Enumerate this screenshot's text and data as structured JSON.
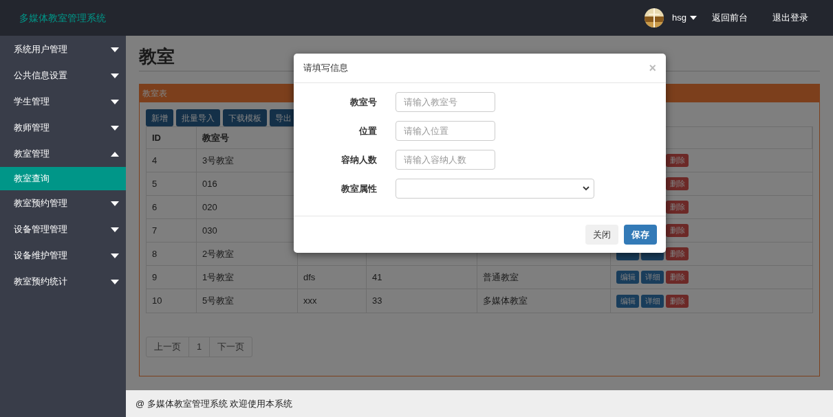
{
  "header": {
    "brand": "多媒体教室管理系统",
    "user": "hsg",
    "links": [
      "返回前台",
      "退出登录"
    ]
  },
  "sidebar": {
    "items": [
      {
        "label": "系统用户管理",
        "expanded": false
      },
      {
        "label": "公共信息设置",
        "expanded": false
      },
      {
        "label": "学生管理",
        "expanded": false
      },
      {
        "label": "教师管理",
        "expanded": false
      },
      {
        "label": "教室管理",
        "expanded": true,
        "children": [
          {
            "label": "教室查询",
            "selected": true
          }
        ]
      },
      {
        "label": "教室预约管理",
        "expanded": false
      },
      {
        "label": "设备管理管理",
        "expanded": false
      },
      {
        "label": "设备维护管理",
        "expanded": false
      },
      {
        "label": "教室预约统计",
        "expanded": false
      }
    ]
  },
  "page_title": "教室",
  "panel": {
    "title": "教室表",
    "toolbar": [
      "新增",
      "批量导入",
      "下载模板",
      "导出"
    ],
    "table": {
      "columns": [
        "ID",
        "教室号"
      ],
      "rows": [
        {
          "cells": [
            "4",
            "3号教室"
          ],
          "actions": [
            {
              "kind": "delete",
              "label": "删除"
            }
          ]
        },
        {
          "cells": [
            "5",
            "016"
          ],
          "actions": [
            {
              "kind": "delete",
              "label": "删除"
            }
          ]
        },
        {
          "cells": [
            "6",
            "020"
          ],
          "actions": [
            {
              "kind": "delete",
              "label": "删除"
            }
          ]
        },
        {
          "cells": [
            "7",
            "030"
          ],
          "actions": [
            {
              "kind": "delete",
              "label": "删除"
            }
          ]
        },
        {
          "cells": [
            "8",
            "2号教室"
          ],
          "actions": [
            {
              "kind": "edit"
            },
            {
              "kind": "detail"
            },
            {
              "kind": "delete",
              "label": "删除"
            }
          ]
        },
        {
          "cells": [
            "9",
            "1号教室",
            "dfs",
            "41",
            "普通教室"
          ],
          "actions": [
            {
              "kind": "edit",
              "label": "编辑"
            },
            {
              "kind": "detail",
              "label": "详细"
            },
            {
              "kind": "delete",
              "label": "删除"
            }
          ]
        },
        {
          "cells": [
            "10",
            "5号教室",
            "xxx",
            "33",
            "多媒体教室"
          ],
          "actions": [
            {
              "kind": "edit",
              "label": "编辑"
            },
            {
              "kind": "detail",
              "label": "详细"
            },
            {
              "kind": "delete",
              "label": "删除"
            }
          ]
        }
      ]
    },
    "pagination": [
      "上一页",
      "1",
      "下一页"
    ]
  },
  "footer": "@ 多媒体教室管理系统 欢迎使用本系统",
  "modal": {
    "title": "请填写信息",
    "close": "×",
    "fields": [
      {
        "kind": "text",
        "label": "教室号",
        "placeholder": "请输入教室号"
      },
      {
        "kind": "text",
        "label": "位置",
        "placeholder": "请输入位置"
      },
      {
        "kind": "text",
        "label": "容纳人数",
        "placeholder": "请输入容纳人数"
      },
      {
        "kind": "select",
        "label": "教室属性"
      }
    ],
    "buttons": [
      {
        "kind": "secondary",
        "label": "关闭"
      },
      {
        "kind": "primary",
        "label": "保存"
      }
    ]
  }
}
